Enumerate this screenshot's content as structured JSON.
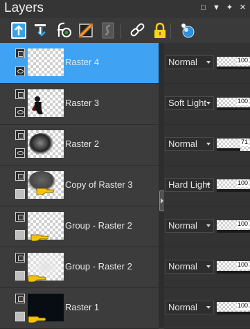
{
  "panel": {
    "title": "Layers"
  },
  "window_controls": [
    {
      "name": "float-toggle-icon",
      "glyph": "□"
    },
    {
      "name": "menu-dropdown-icon",
      "glyph": "▼"
    },
    {
      "name": "pin-icon",
      "glyph": "✦"
    },
    {
      "name": "close-icon",
      "glyph": "✕"
    }
  ],
  "toolbar": [
    "new-raster-layer-icon",
    "new-vector-layer-icon",
    "effects-layer-icon",
    "adjustment-layer-icon",
    "mask-layer-icon",
    "link-layers-icon",
    "lock-transparency-icon",
    "organizer-icon"
  ],
  "layers": [
    {
      "name": "Raster 4",
      "blend": "Normal",
      "opacity": "100",
      "opacity_value": 100,
      "visible": true,
      "selected": true,
      "thumb": "transparent"
    },
    {
      "name": "Raster 3",
      "blend": "Soft Light",
      "opacity": "100",
      "opacity_value": 100,
      "visible": true,
      "selected": false,
      "thumb": "figure"
    },
    {
      "name": "Raster 2",
      "blend": "Normal",
      "opacity": "71",
      "opacity_value": 71,
      "visible": true,
      "selected": false,
      "thumb": "orb"
    },
    {
      "name": "Copy of Raster 3",
      "blend": "Hard Light",
      "opacity": "100",
      "opacity_value": 100,
      "visible": false,
      "selected": false,
      "thumb": "orb-soft"
    },
    {
      "name": "Group - Raster 2",
      "blend": "Normal",
      "opacity": "100",
      "opacity_value": 100,
      "visible": false,
      "selected": false,
      "thumb": "transparent"
    },
    {
      "name": "Group - Raster 2",
      "blend": "Normal",
      "opacity": "100",
      "opacity_value": 100,
      "visible": false,
      "selected": false,
      "thumb": "haze"
    },
    {
      "name": "Raster 1",
      "blend": "Normal",
      "opacity": "100",
      "opacity_value": 100,
      "visible": false,
      "selected": false,
      "thumb": "dark"
    }
  ],
  "colors": {
    "selection": "#3fa2f2",
    "panel_bg": "#3c3c3c",
    "hand_icon": "#f5c400"
  }
}
